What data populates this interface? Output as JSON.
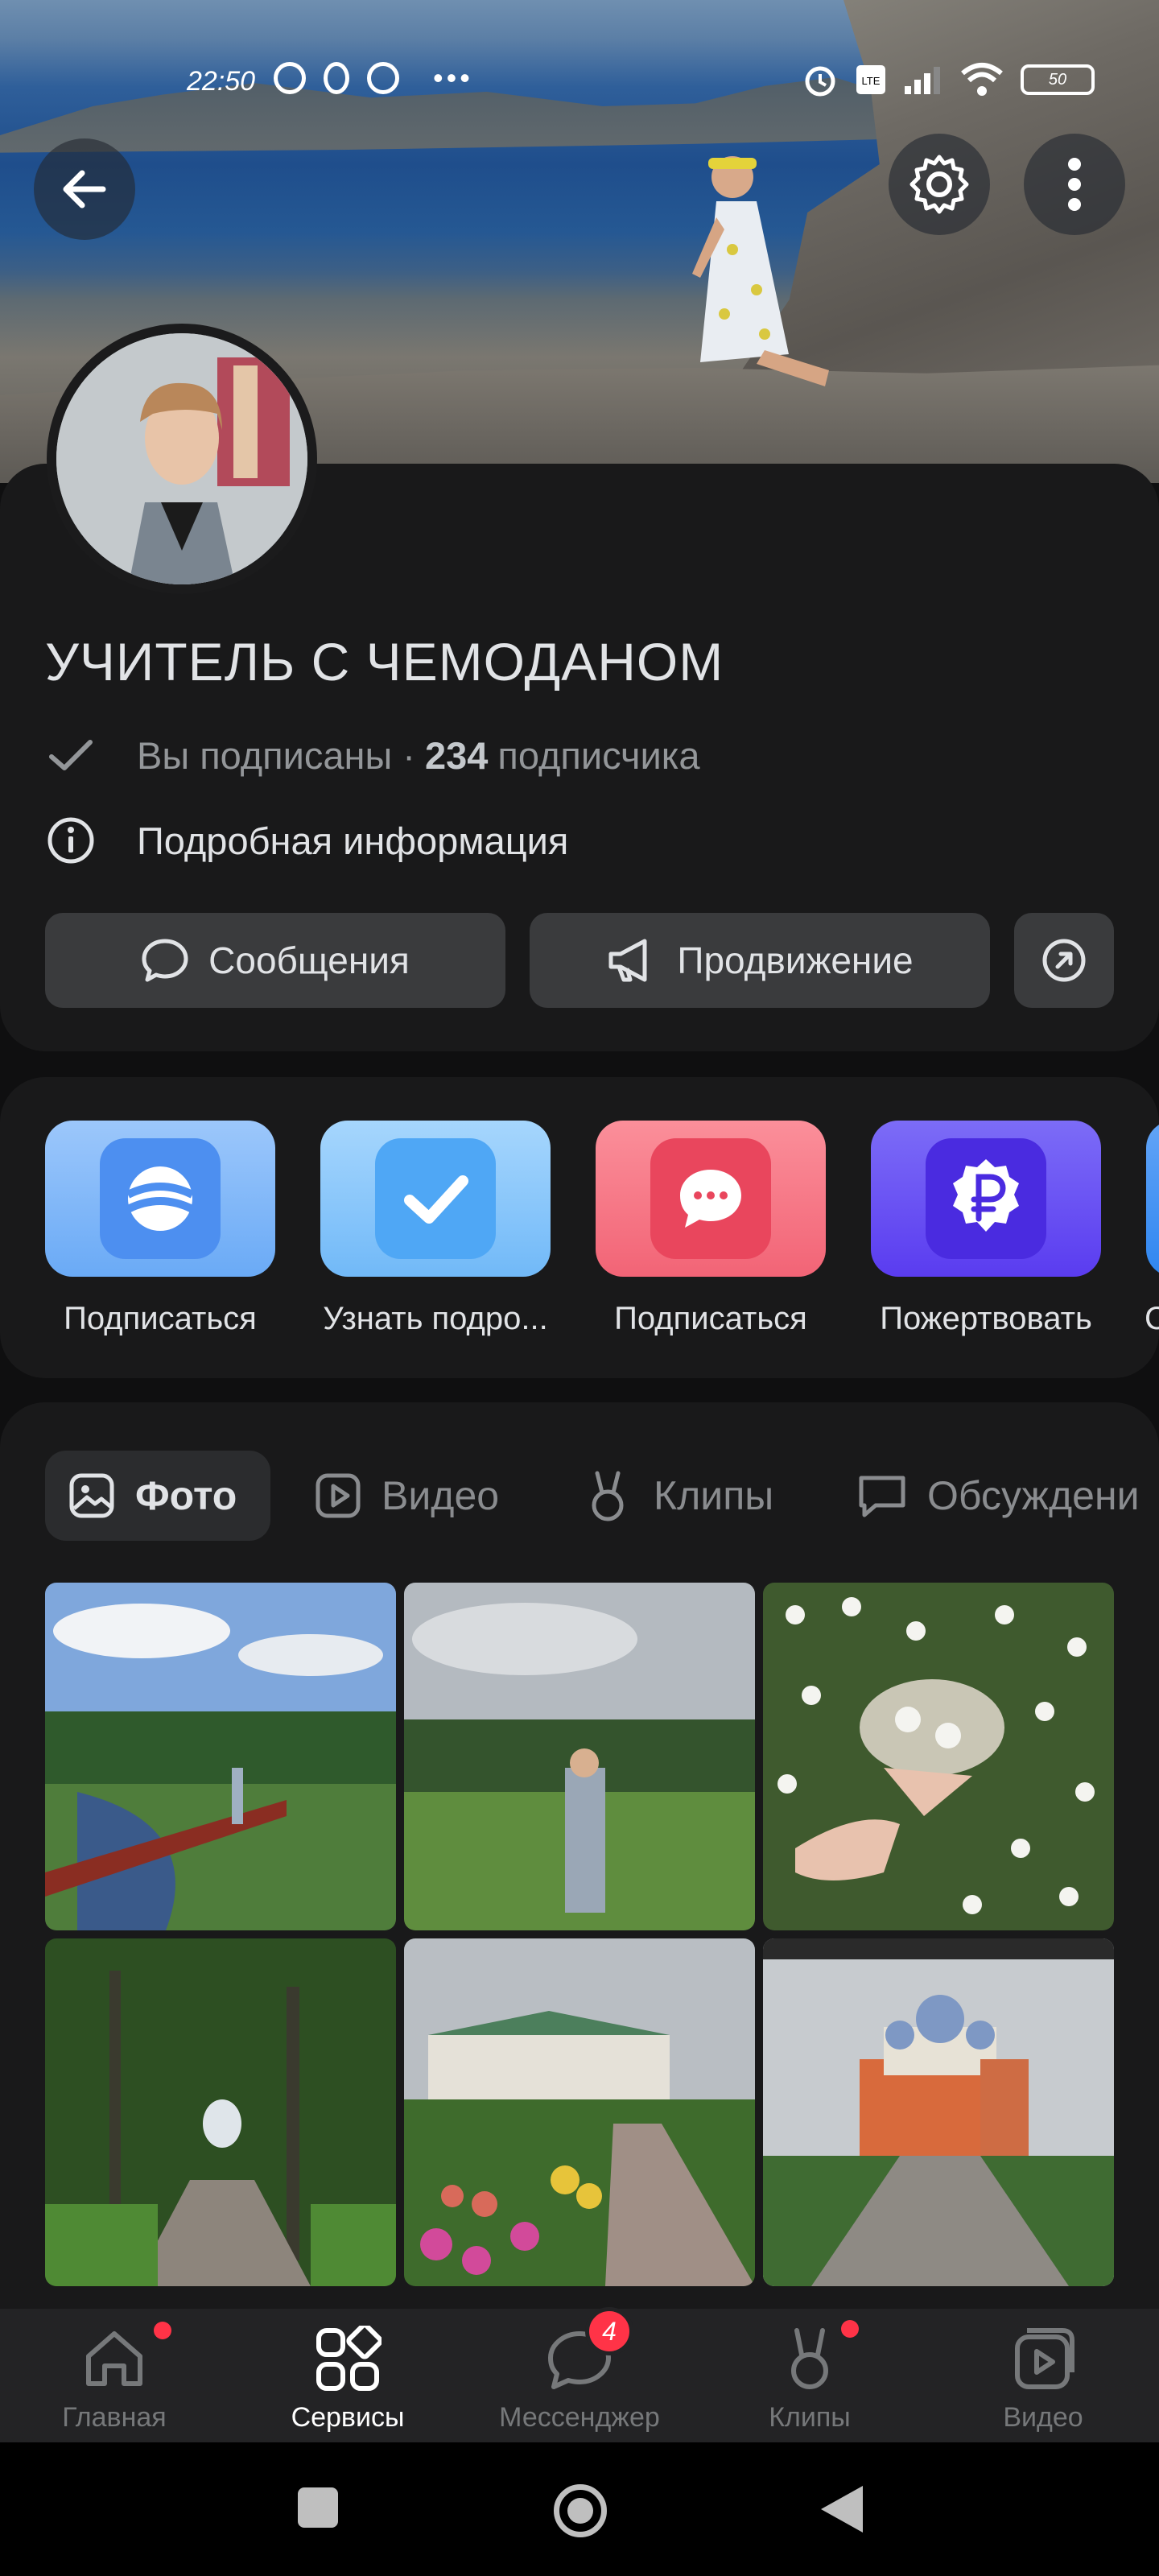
{
  "status_bar": {
    "time": "22:50",
    "battery": "50"
  },
  "header": {
    "back_icon": "arrow-left-icon",
    "settings_icon": "gear-icon",
    "more_icon": "more-vertical-icon"
  },
  "profile": {
    "name": "УЧИТЕЛЬ С ЧЕМОДАНОМ",
    "subscribed_text": "Вы подписаны ·",
    "subscribers_count": "234",
    "subscribers_word": "подписчика",
    "details_label": "Подробная информация"
  },
  "actions": {
    "messages_label": "Сообщения",
    "promo_label": "Продвижение",
    "share_icon": "share-arrow-icon"
  },
  "apps": [
    {
      "label": "Подписаться",
      "icon": "sphere-logo-icon",
      "color": "#5aa2f5"
    },
    {
      "label": "Узнать подро...",
      "icon": "checkmark-icon",
      "color": "#5ab3f7"
    },
    {
      "label": "Подписаться",
      "icon": "chat-bubble-icon",
      "color": "#f06577"
    },
    {
      "label": "Пожертвовать",
      "icon": "ruble-icon",
      "color": "#5b3df0"
    },
    {
      "label": "С",
      "icon": "app-icon",
      "color": "#2f86f0"
    }
  ],
  "media_tabs": [
    {
      "label": "Фото",
      "icon": "photo-icon",
      "active": true
    },
    {
      "label": "Видео",
      "icon": "video-icon",
      "active": false
    },
    {
      "label": "Клипы",
      "icon": "clips-icon",
      "active": false
    },
    {
      "label": "Обсуждени",
      "icon": "discussion-icon",
      "active": false
    }
  ],
  "bottom_nav": [
    {
      "label": "Главная",
      "icon": "home-icon",
      "dot": true
    },
    {
      "label": "Сервисы",
      "icon": "services-grid-icon",
      "active": true
    },
    {
      "label": "Мессенджер",
      "icon": "messenger-icon",
      "badge": "4"
    },
    {
      "label": "Клипы",
      "icon": "clips-icon",
      "dot": true
    },
    {
      "label": "Видео",
      "icon": "video-icon"
    }
  ],
  "colors": {
    "background": "#19191a",
    "accent_red": "#ff3347",
    "button_bg": "#3a3b3d"
  }
}
